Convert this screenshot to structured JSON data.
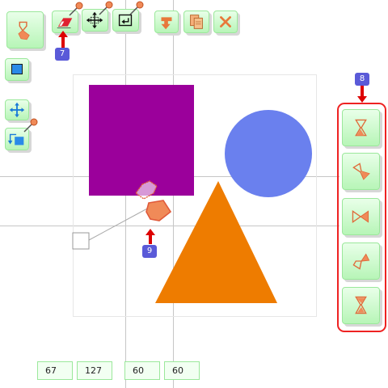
{
  "toolbar": {
    "icons": [
      "hourglass-icon",
      "eraser-icon",
      "move-arrows-icon",
      "rotate-frame-icon",
      "down-arrow-icon",
      "copy-icon",
      "close-icon"
    ]
  },
  "left_tools": {
    "icons": [
      "rectangle-icon",
      "move-arrows-icon",
      "rotate-shape-icon"
    ]
  },
  "markers": {
    "toolbar_step": "7",
    "rotation_panel_step": "8",
    "canvas_step": "9"
  },
  "canvas": {
    "shapes": [
      {
        "kind": "square",
        "color": "#9b009b"
      },
      {
        "kind": "circle",
        "color": "#6a80ee"
      },
      {
        "kind": "triangle",
        "color": "#ee7c00"
      }
    ]
  },
  "rotation_panel": {
    "icons": [
      "hourglass-rotate-0-icon",
      "hourglass-rotate-45-icon",
      "hourglass-rotate-90-icon",
      "hourglass-rotate-135-icon",
      "hourglass-flip-icon"
    ],
    "highlight_color": "#ee2222"
  },
  "fields": {
    "x": "67",
    "y": "127",
    "width": "60",
    "height": "60"
  },
  "colors": {
    "button_green": "#b7f5b7",
    "marker_blue": "#5a5ad8",
    "arrow_red": "#dd0000",
    "icon_orange": "#ee7c40"
  }
}
